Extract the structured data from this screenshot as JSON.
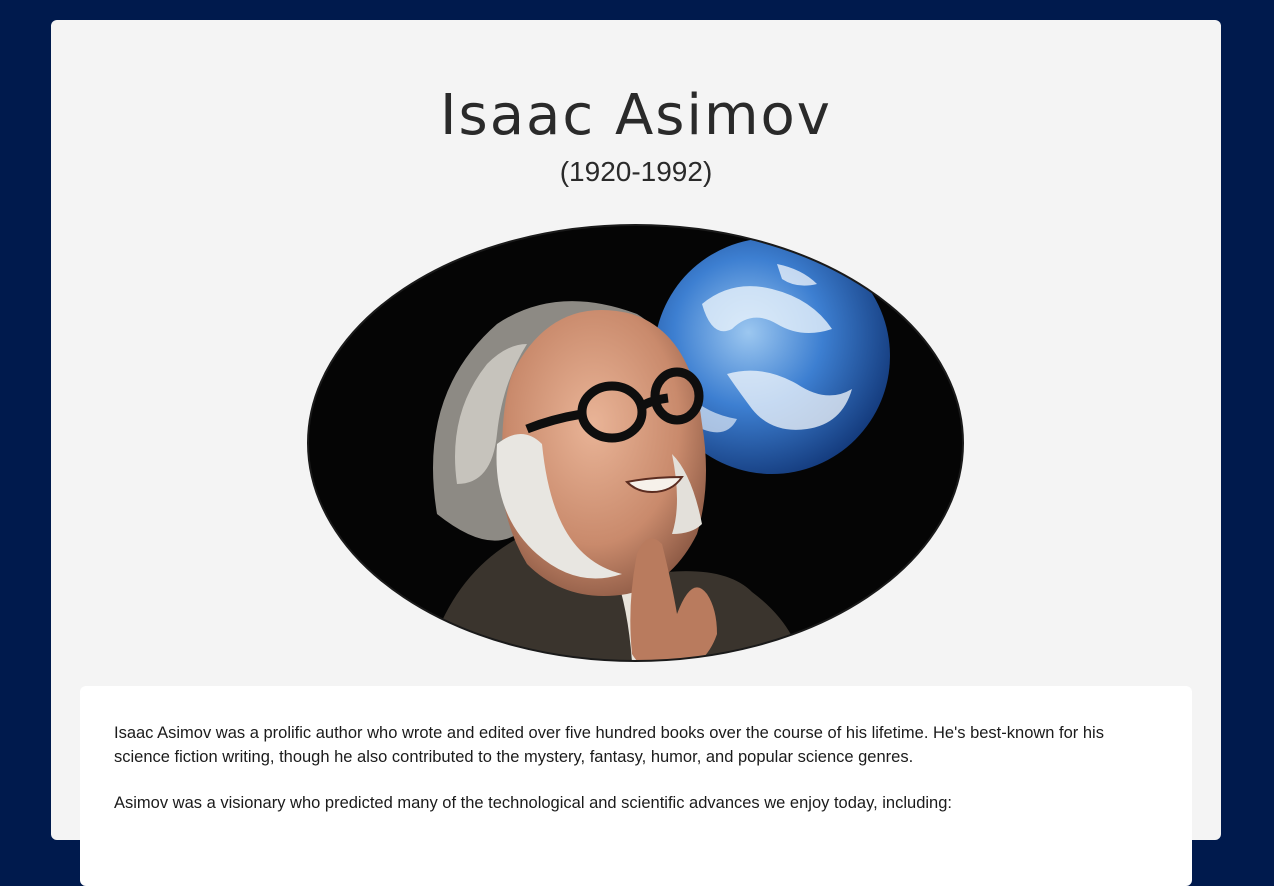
{
  "header": {
    "title": "Isaac Asimov",
    "dates": "(1920-1992)"
  },
  "portrait": {
    "description": "Isaac Asimov with Earth",
    "background_color": "#050505",
    "planet_color": "#3d7fd1"
  },
  "bio": {
    "paragraph_1": "Isaac Asimov was a prolific author who wrote and edited over five hundred books over the course of his lifetime. He's best-known for his science fiction writing, though he also contributed to the mystery, fantasy, humor, and popular science genres.",
    "paragraph_2": "Asimov was a visionary who predicted many of the technological and scientific advances we enjoy today, including:"
  },
  "colors": {
    "page_background": "#001a4d",
    "panel": "#f4f4f4",
    "card": "#ffffff",
    "text": "#2a2a2a"
  }
}
